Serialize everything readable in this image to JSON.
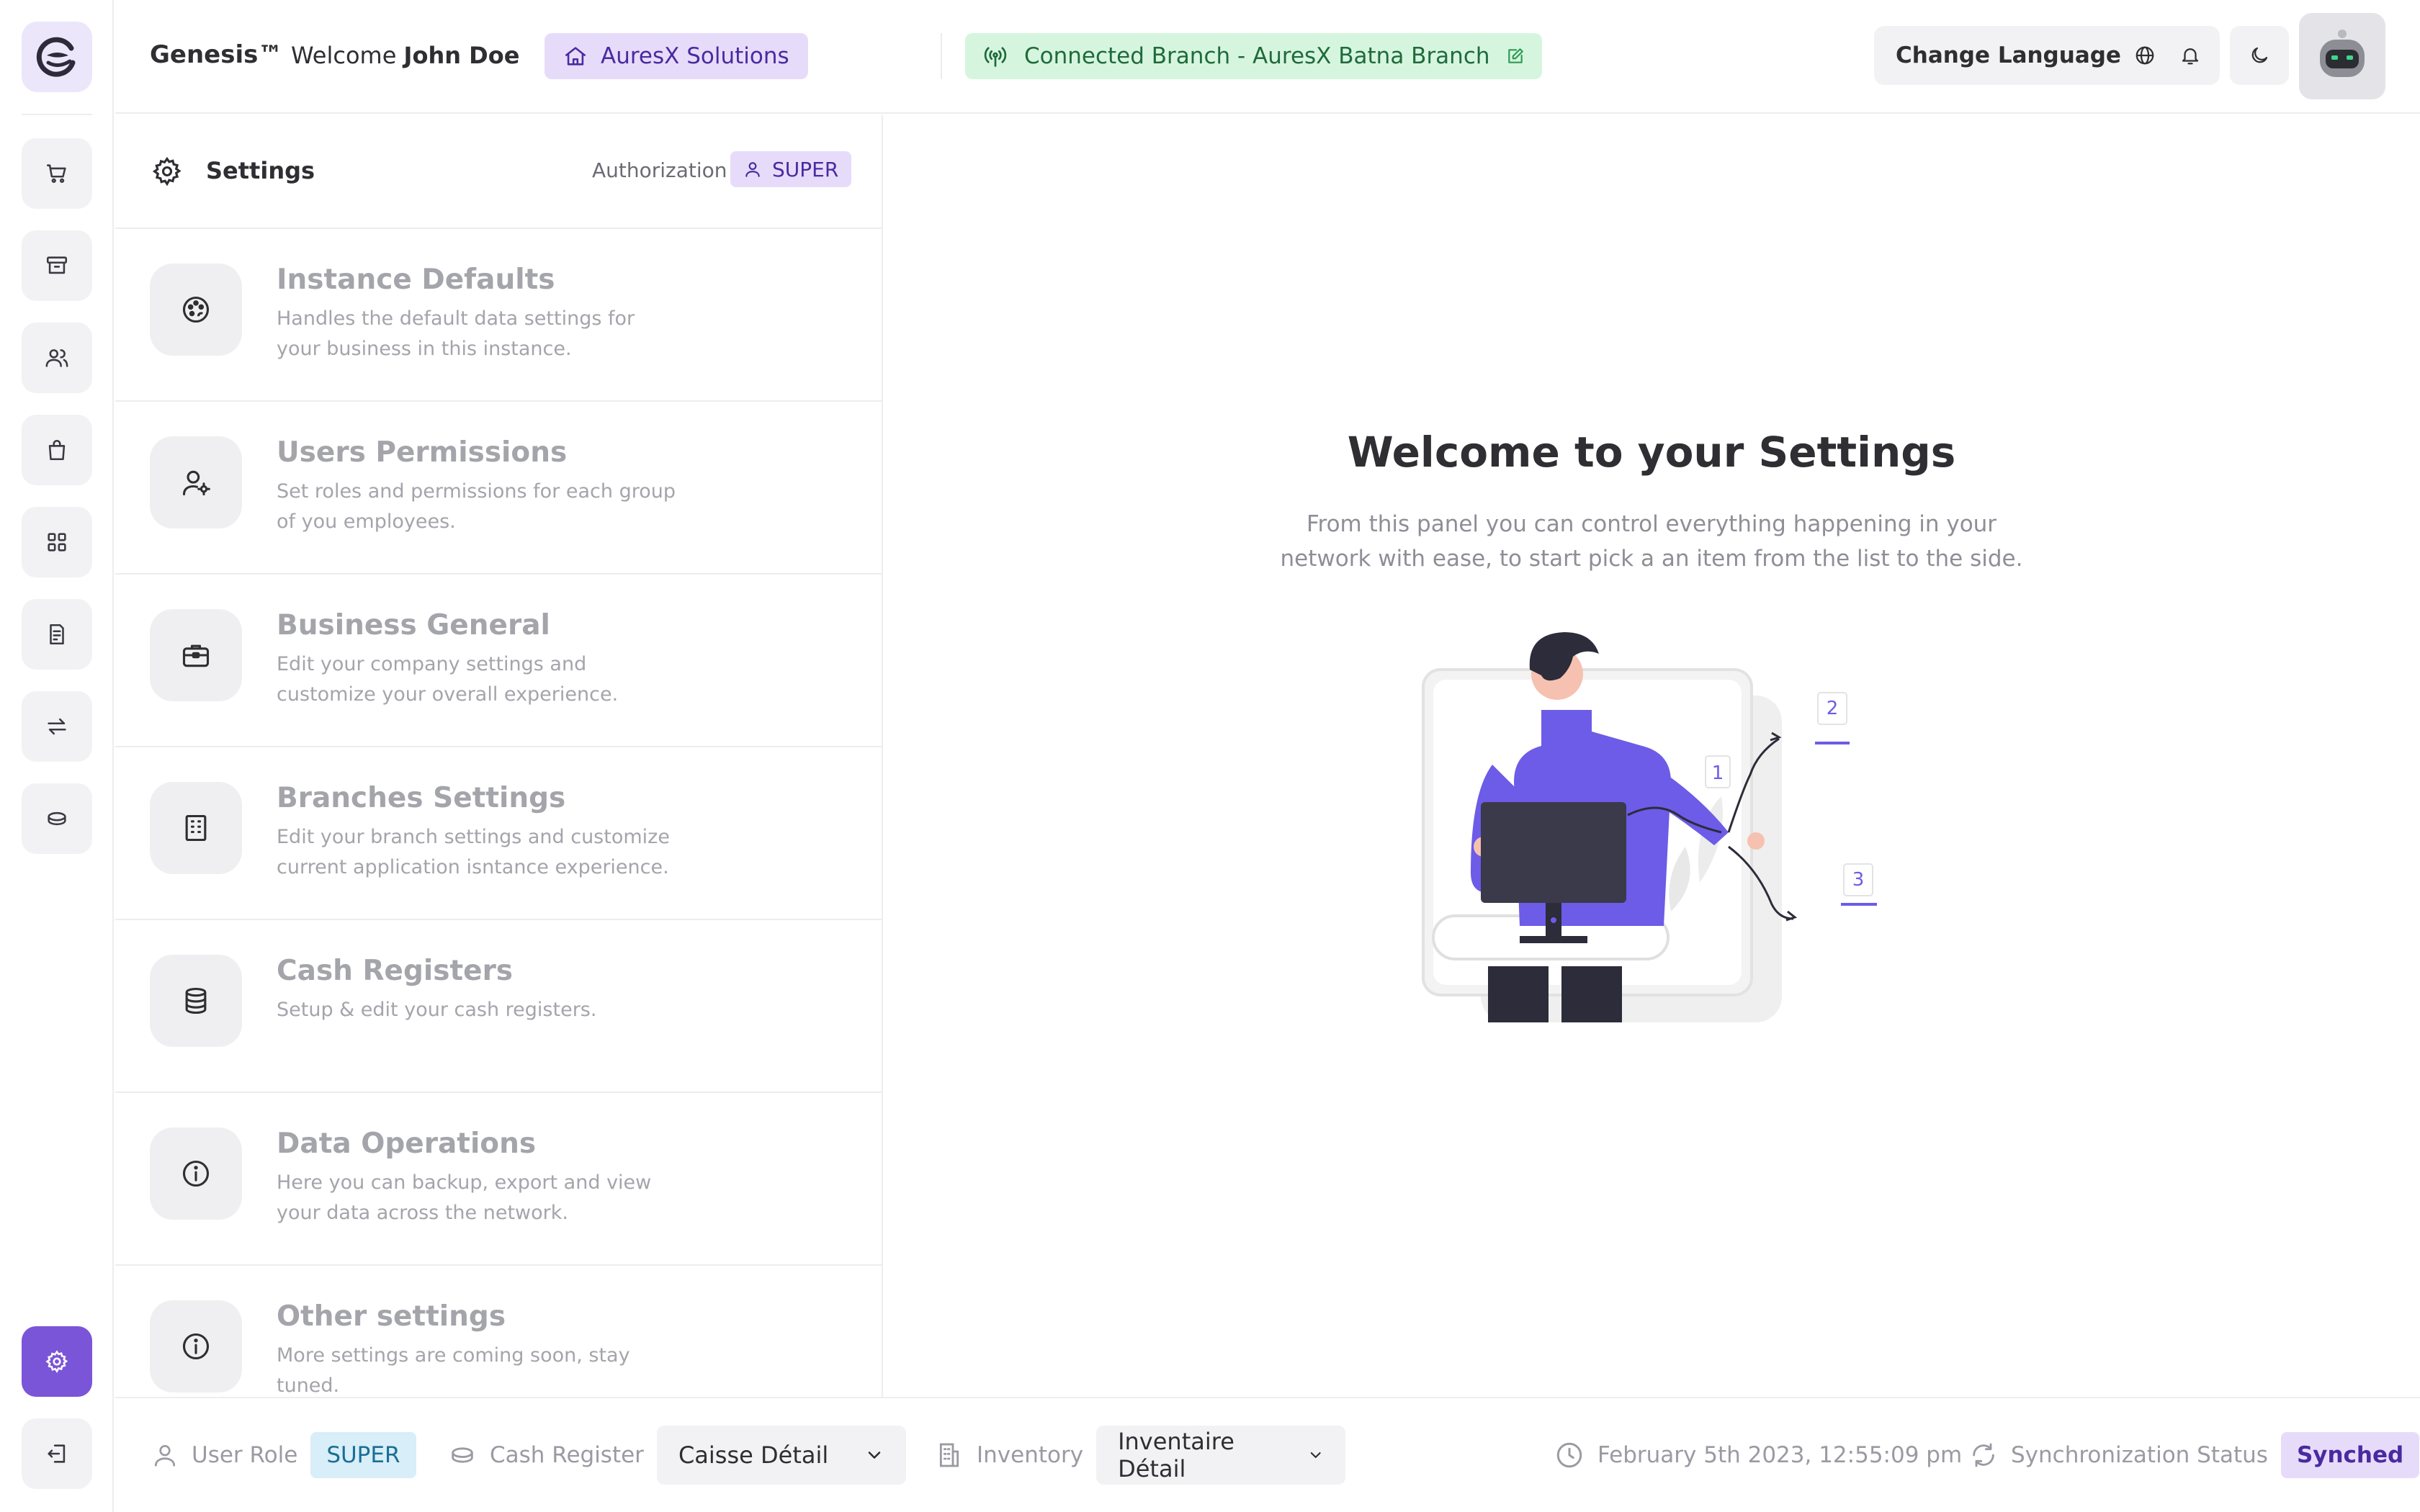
{
  "header": {
    "brand": "Genesis™",
    "welcome_prefix": "Welcome",
    "user_name": "John Doe",
    "company": "AuresX Solutions",
    "branch": "Connected Branch - AuresX Batna Branch",
    "change_language": "Change Language"
  },
  "settings_panel": {
    "title": "Settings",
    "authorization_label": "Authorization",
    "authorization_value": "SUPER",
    "items": [
      {
        "title": "Instance Defaults",
        "description": "Handles the default data settings for your business in this instance.",
        "icon": "palette-icon"
      },
      {
        "title": "Users Permissions",
        "description": "Set roles and permissions for each group of you employees.",
        "icon": "user-gear-icon"
      },
      {
        "title": "Business General",
        "description": "Edit your company settings and customize your overall experience.",
        "icon": "briefcase-icon"
      },
      {
        "title": "Branches Settings",
        "description": "Edit your branch settings and customize current application isntance experience.",
        "icon": "building-icon"
      },
      {
        "title": "Cash Registers",
        "description": "Setup & edit your cash registers.",
        "icon": "database-icon"
      },
      {
        "title": "Data Operations",
        "description": "Here you can backup, export and view your data across the network.",
        "icon": "info-icon"
      },
      {
        "title": "Other settings",
        "description": "More settings are coming soon, stay tuned.",
        "icon": "info-icon"
      }
    ]
  },
  "main": {
    "title": "Welcome to your Settings",
    "description": "From this panel you can control everything happening in your network with ease, to start pick a an item from the list to the side.",
    "illustration_labels": [
      "1",
      "2",
      "3"
    ]
  },
  "footer": {
    "user_role_label": "User Role",
    "user_role_value": "SUPER",
    "cash_register_label": "Cash Register",
    "cash_register_value": "Caisse Détail",
    "inventory_label": "Inventory",
    "inventory_value": "Inventaire Détail",
    "datetime": "February 5th 2023, 12:55:09 pm",
    "sync_label": "Synchronization Status",
    "sync_value": "Synched"
  },
  "colors": {
    "accent": "#7b55d8",
    "accent_soft": "#e6dcfa",
    "success_soft": "#d6f5df",
    "info_soft": "#d8eef8"
  }
}
